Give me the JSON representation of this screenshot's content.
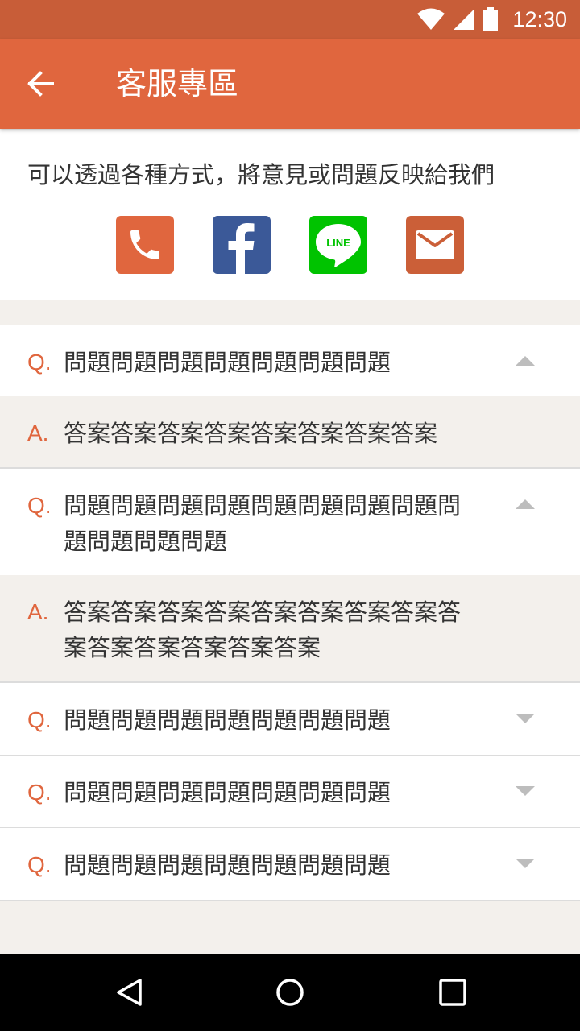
{
  "status_bar": {
    "time": "12:30",
    "icons": [
      "wifi-icon",
      "signal-icon",
      "battery-icon"
    ]
  },
  "app_bar": {
    "title": "客服專區",
    "back_icon": "arrow-back-icon"
  },
  "contact": {
    "description": "可以透過各種方式，將意見或問題反映給我們",
    "channels": [
      {
        "name": "phone",
        "icon": "phone-icon",
        "color": "#e0663e"
      },
      {
        "name": "facebook",
        "icon": "facebook-icon",
        "color": "#3b5998"
      },
      {
        "name": "line",
        "icon": "line-icon",
        "label": "LINE",
        "color": "#00c300"
      },
      {
        "name": "email",
        "icon": "mail-icon",
        "color": "#cb5f38"
      }
    ]
  },
  "faq": {
    "q_prefix": "Q.",
    "a_prefix": "A.",
    "items": [
      {
        "question": "問題問題問題問題問題問題問題",
        "answer": "答案答案答案答案答案答案答案答案",
        "expanded": true
      },
      {
        "question": "問題問題問題問題問題問題問題問題問題問題問題問題",
        "answer": "答案答案答案答案答案答案答案答案答案答案答案答案答案答案",
        "expanded": true
      },
      {
        "question": "問題問題問題問題問題問題問題",
        "expanded": false
      },
      {
        "question": "問題問題問題問題問題問題問題",
        "expanded": false
      },
      {
        "question": "問題問題問題問題問題問題問題",
        "expanded": false
      }
    ]
  },
  "nav_bar": {
    "icons": [
      "back-triangle-icon",
      "home-circle-icon",
      "recents-square-icon"
    ]
  },
  "colors": {
    "accent": "#e0663e",
    "status_bar": "#c85d38",
    "background": "#f3f0ec"
  }
}
